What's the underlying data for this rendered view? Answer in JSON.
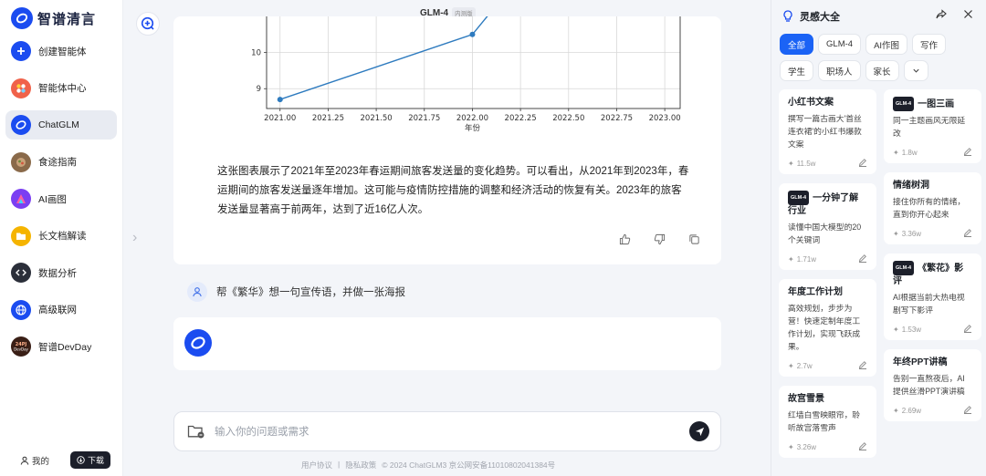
{
  "app": {
    "logo_text": "智谱清言"
  },
  "sidebar": {
    "items": [
      {
        "label": "创建智能体",
        "icon": "plus-icon",
        "color": "#1b4cf0"
      },
      {
        "label": "智能体中心",
        "icon": "agent-center-icon",
        "color": "#f0624a"
      },
      {
        "label": "ChatGLM",
        "icon": "chatglm-icon",
        "color": "#1b4cf0"
      },
      {
        "label": "食途指南",
        "icon": "food-guide-icon",
        "color": "#8a6a4a"
      },
      {
        "label": "AI画图",
        "icon": "ai-draw-icon",
        "color": "#7b3ff2"
      },
      {
        "label": "长文档解读",
        "icon": "document-icon",
        "color": "#f5b400"
      },
      {
        "label": "数据分析",
        "icon": "code-icon",
        "color": "#2b2f3a"
      },
      {
        "label": "高级联网",
        "icon": "globe-icon",
        "color": "#1b4cf0"
      },
      {
        "label": "智谱DevDay",
        "icon": "devday-icon",
        "color": "#3a1f16"
      }
    ],
    "me_label": "我的",
    "download_label": "下载"
  },
  "header": {
    "model_name": "GLM-4",
    "model_badge": "内测版"
  },
  "chart_data": {
    "type": "line",
    "x": [
      2021.0,
      2022.0
    ],
    "series": [
      {
        "values": [
          8.7,
          10.5
        ]
      }
    ],
    "x_ticks": [
      "2021.00",
      "2021.25",
      "2021.50",
      "2021.75",
      "2022.00",
      "2022.25",
      "2022.50",
      "2022.75",
      "2023.00"
    ],
    "y_ticks": [
      "9",
      "10"
    ],
    "xlabel": "年份",
    "ylabel": "",
    "xlim": [
      2020.93,
      2023.08
    ],
    "ylim": [
      8.45,
      11.0
    ],
    "color": "#2e7bbf"
  },
  "conversation": {
    "answer": "这张图表展示了2021年至2023年春运期间旅客发送量的变化趋势。可以看出，从2021年到2023年，春运期间的旅客发送量逐年增加。这可能与疫情防控措施的调整和经济活动的恢复有关。2023年的旅客发送量显著高于前两年，达到了近16亿人次。",
    "user_message": "帮《繁华》想一句宣传语，并做一张海报"
  },
  "input": {
    "placeholder": "输入你的问题或需求"
  },
  "footer": {
    "terms": "用户协议",
    "privacy": "隐私政策",
    "record": "© 2024 ChatGLM3 京公网安备11010802041384号"
  },
  "panel": {
    "title": "灵感大全",
    "chips": [
      "全部",
      "GLM-4",
      "AI作图",
      "写作",
      "学生",
      "职场人",
      "家长"
    ],
    "left_cards": [
      {
        "title": "小红书文案",
        "tag": "",
        "desc": "撰写一篇古画大'首丝连衣裙'的小红书爆款文案",
        "count": "11.5w"
      },
      {
        "title": "一分钟了解行业",
        "tag": "GLM-4",
        "desc": "读懂中国大模型的20个关键词",
        "count": "1.71w"
      },
      {
        "title": "年度工作计划",
        "tag": "",
        "desc": "高效规划，步步为营！快速定制年度工作计划，实现飞跃成果。",
        "count": "2.7w"
      },
      {
        "title": "故宫雪景",
        "tag": "",
        "desc": "红墙白雪映眼帘，聆听故宫落雪声",
        "count": "3.26w"
      }
    ],
    "right_cards": [
      {
        "title": "一图三画",
        "tag": "GLM-4",
        "desc": "同一主题画风无限延改",
        "count": "1.8w"
      },
      {
        "title": "情绪树洞",
        "tag": "",
        "desc": "接住你所有的情绪，直到你开心起来",
        "count": "3.36w"
      },
      {
        "title": "《繁花》影评",
        "tag": "GLM-4",
        "desc": "AI根据当前大热电视剧写下影评",
        "count": "1.53w"
      },
      {
        "title": "年终PPT讲稿",
        "tag": "",
        "desc": "告别一直熬夜后，AI提供丝滑PPT演讲稿",
        "count": "2.69w"
      }
    ]
  }
}
